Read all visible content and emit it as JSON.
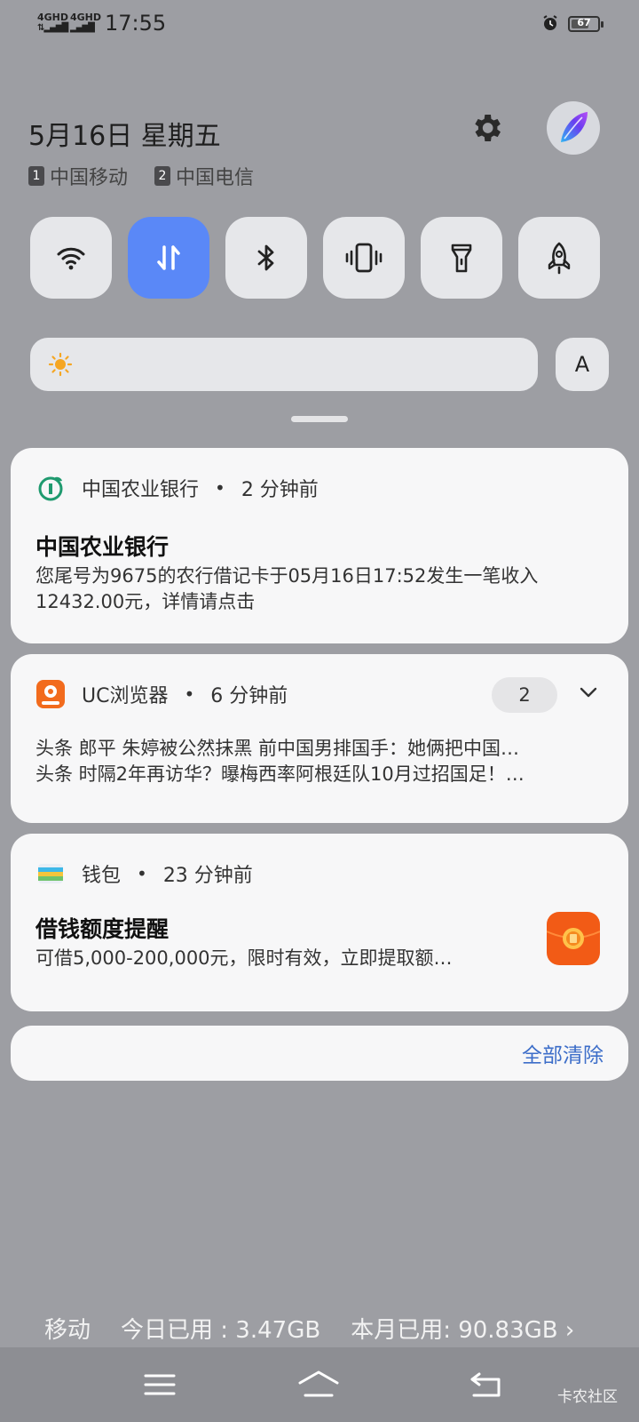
{
  "status_bar": {
    "sim1_network": "4GHD",
    "sim2_network": "4GHD",
    "time": "17:55",
    "battery_level": "67",
    "battery_fraction": 0.67
  },
  "header": {
    "date": "5月16日 星期五",
    "carriers": [
      {
        "sim": "1",
        "name": "中国移动"
      },
      {
        "sim": "2",
        "name": "中国电信"
      }
    ]
  },
  "quick_settings": {
    "tiles": [
      {
        "id": "wifi",
        "icon": "wifi-icon",
        "active": false
      },
      {
        "id": "mobile-data",
        "icon": "data-transfer-icon",
        "active": true
      },
      {
        "id": "bluetooth",
        "icon": "bluetooth-icon",
        "active": false
      },
      {
        "id": "vibrate",
        "icon": "vibrate-icon",
        "active": false
      },
      {
        "id": "flashlight",
        "icon": "flashlight-icon",
        "active": false
      },
      {
        "id": "rocket",
        "icon": "rocket-icon",
        "active": false
      }
    ],
    "brightness_auto_label": "A",
    "active_color": "#5a88f7"
  },
  "notifications": [
    {
      "app": "中国农业银行",
      "time": "2 分钟前",
      "title": "中国农业银行",
      "lines": [
        "您尾号为9675的农行借记卡于05月16日17:52发生一笔收入",
        "12432.00元，详情请点击"
      ]
    },
    {
      "app": "UC浏览器",
      "time": "6 分钟前",
      "count": "2",
      "lines": [
        "头条  郎平 朱婷被公然抹黑 前中国男排国手：她俩把中国…",
        "头条  时隔2年再访华？曝梅西率阿根廷队10月过招国足！…"
      ]
    },
    {
      "app": "钱包",
      "time": "23 分钟前",
      "title": "借钱额度提醒",
      "lines": [
        "可借5,000-200,000元，限时有效，立即提取额…"
      ]
    }
  ],
  "clear_all_label": "全部清除",
  "data_usage": {
    "carrier": "移动",
    "today": "今日已用 : 3.47GB",
    "month": "本月已用: 90.83GB",
    "chevron": "›"
  },
  "watermark": "卡农社区",
  "colors": {
    "background": "#9d9ea3",
    "accent_blue": "#3d6ec9",
    "abc_green": "#1f9a6f",
    "uc_orange": "#f26b1d"
  }
}
